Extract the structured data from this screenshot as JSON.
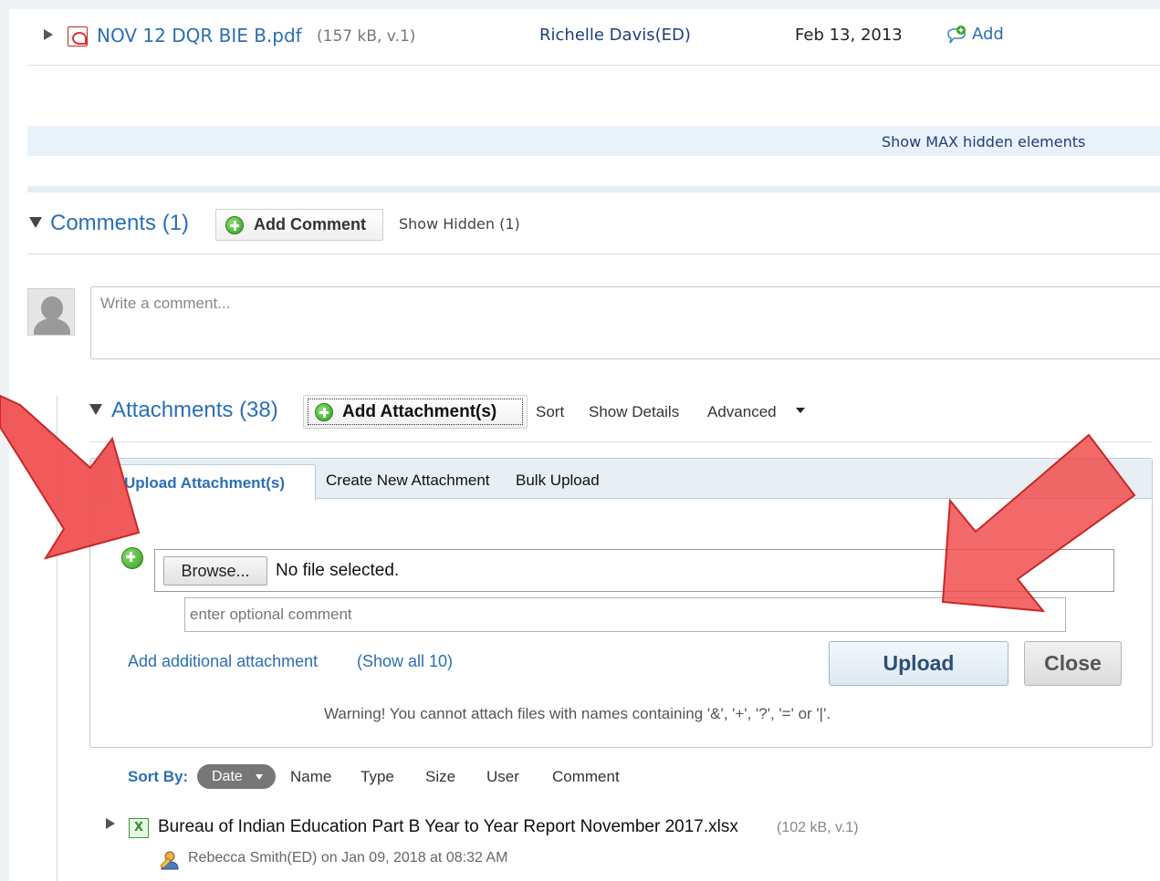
{
  "file_row": {
    "name": "NOV 12 DQR BIE B.pdf",
    "meta": "(157 kB, v.1)",
    "author": "Richelle Davis(ED)",
    "date": "Feb 13, 2013",
    "add_label": "Add"
  },
  "show_hidden_label": "Show MAX hidden elements",
  "comments": {
    "title": "Comments (1)",
    "add_label": "Add Comment",
    "show_hidden": "Show Hidden (1)",
    "placeholder": "Write a comment..."
  },
  "attachments": {
    "title": "Attachments (38)",
    "add_label": "Add Attachment(s)",
    "menu": [
      "Sort",
      "Show Details",
      "Advanced"
    ],
    "tabs": [
      "Upload Attachment(s)",
      "Create New Attachment",
      "Bulk Upload"
    ],
    "browse_label": "Browse...",
    "no_file": "No file selected.",
    "comment_placeholder": "enter optional comment",
    "add_additional": "Add additional attachment",
    "show_all": "(Show all 10)",
    "upload_label": "Upload",
    "close_label": "Close",
    "warning": "Warning! You cannot attach files with names containing '&', '+', '?', '=' or '|'."
  },
  "sort_bar": {
    "label": "Sort By:",
    "active": "Date",
    "options": [
      "Name",
      "Type",
      "Size",
      "User",
      "Comment"
    ]
  },
  "attachment_item": {
    "name": "Bureau of Indian Education Part B Year to Year Report November 2017.xlsx",
    "meta": "(102 kB, v.1)",
    "byline": "Rebecca Smith(ED) on Jan 09, 2018 at 08:32 AM"
  },
  "colors": {
    "link": "#2b6fb5",
    "arrow_fill": "#f04848",
    "arrow_stroke": "#c82828"
  }
}
